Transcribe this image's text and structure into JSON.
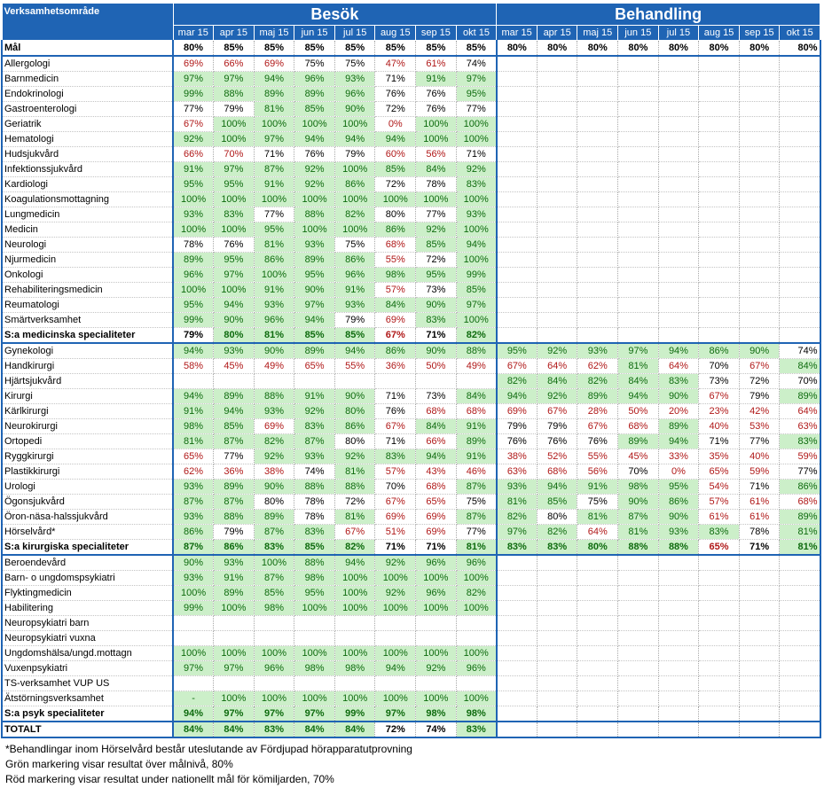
{
  "header": {
    "row_label": "Verksamhetsområde",
    "section_besok": "Besök",
    "section_behandling": "Behandling",
    "months": [
      "mar 15",
      "apr 15",
      "maj 15",
      "jun 15",
      "jul 15",
      "aug 15",
      "sep 15",
      "okt 15"
    ]
  },
  "colors": {
    "header_bg": "#1f64b4",
    "green_fill": "#ccefc9",
    "green_text": "#0e6b0e",
    "red_text": "#b01818"
  },
  "goal_row": {
    "name": "Mål",
    "besok": [
      "80%",
      "85%",
      "85%",
      "85%",
      "85%",
      "85%",
      "85%",
      "85%"
    ],
    "behandling": [
      "80%",
      "80%",
      "80%",
      "80%",
      "80%",
      "80%",
      "80%",
      "80%"
    ]
  },
  "groups": [
    {
      "rows": [
        {
          "name": "Allergologi",
          "besok": [
            "r69%",
            "r66%",
            "r69%",
            "75%",
            "75%",
            "r47%",
            "r61%",
            "74%"
          ],
          "behandling": [
            "",
            "",
            "",
            "",
            "",
            "",
            "",
            ""
          ]
        },
        {
          "name": "Barnmedicin",
          "besok": [
            "g97%",
            "g97%",
            "g94%",
            "g96%",
            "g93%",
            "71%",
            "g91%",
            "g97%"
          ],
          "behandling": [
            "",
            "",
            "",
            "",
            "",
            "",
            "",
            ""
          ]
        },
        {
          "name": "Endokrinologi",
          "besok": [
            "g99%",
            "g88%",
            "g89%",
            "g89%",
            "g96%",
            "76%",
            "76%",
            "g95%"
          ],
          "behandling": [
            "",
            "",
            "",
            "",
            "",
            "",
            "",
            ""
          ]
        },
        {
          "name": "Gastroenterologi",
          "besok": [
            "77%",
            "79%",
            "g81%",
            "g85%",
            "g90%",
            "72%",
            "76%",
            "77%"
          ],
          "behandling": [
            "",
            "",
            "",
            "",
            "",
            "",
            "",
            ""
          ]
        },
        {
          "name": "Geriatrik",
          "besok": [
            "r67%",
            "g100%",
            "g100%",
            "g100%",
            "g100%",
            "r0%",
            "g100%",
            "g100%"
          ],
          "behandling": [
            "",
            "",
            "",
            "",
            "",
            "",
            "",
            ""
          ]
        },
        {
          "name": "Hematologi",
          "besok": [
            "g92%",
            "g100%",
            "g97%",
            "g94%",
            "g94%",
            "g94%",
            "g100%",
            "g100%"
          ],
          "behandling": [
            "",
            "",
            "",
            "",
            "",
            "",
            "",
            ""
          ]
        },
        {
          "name": "Hudsjukvård",
          "besok": [
            "r66%",
            "r70%",
            "71%",
            "76%",
            "79%",
            "r60%",
            "r56%",
            "71%"
          ],
          "behandling": [
            "",
            "",
            "",
            "",
            "",
            "",
            "",
            ""
          ]
        },
        {
          "name": "Infektionssjukvård",
          "besok": [
            "g91%",
            "g97%",
            "g87%",
            "g92%",
            "g100%",
            "g85%",
            "g84%",
            "g92%"
          ],
          "behandling": [
            "",
            "",
            "",
            "",
            "",
            "",
            "",
            ""
          ]
        },
        {
          "name": "Kardiologi",
          "besok": [
            "g95%",
            "g95%",
            "g91%",
            "g92%",
            "g86%",
            "72%",
            "78%",
            "g83%"
          ],
          "behandling": [
            "",
            "",
            "",
            "",
            "",
            "",
            "",
            ""
          ]
        },
        {
          "name": "Koagulationsmottagning",
          "besok": [
            "g100%",
            "g100%",
            "g100%",
            "g100%",
            "g100%",
            "g100%",
            "g100%",
            "g100%"
          ],
          "behandling": [
            "",
            "",
            "",
            "",
            "",
            "",
            "",
            ""
          ]
        },
        {
          "name": "Lungmedicin",
          "besok": [
            "g93%",
            "g83%",
            "77%",
            "g88%",
            "g82%",
            "80%",
            "77%",
            "g93%"
          ],
          "behandling": [
            "",
            "",
            "",
            "",
            "",
            "",
            "",
            ""
          ]
        },
        {
          "name": "Medicin",
          "besok": [
            "g100%",
            "g100%",
            "g95%",
            "g100%",
            "g100%",
            "g86%",
            "g92%",
            "g100%"
          ],
          "behandling": [
            "",
            "",
            "",
            "",
            "",
            "",
            "",
            ""
          ]
        },
        {
          "name": "Neurologi",
          "besok": [
            "78%",
            "76%",
            "g81%",
            "g93%",
            "75%",
            "r68%",
            "g85%",
            "g94%"
          ],
          "behandling": [
            "",
            "",
            "",
            "",
            "",
            "",
            "",
            ""
          ]
        },
        {
          "name": "Njurmedicin",
          "besok": [
            "g89%",
            "g95%",
            "g86%",
            "g89%",
            "g86%",
            "r55%",
            "72%",
            "g100%"
          ],
          "behandling": [
            "",
            "",
            "",
            "",
            "",
            "",
            "",
            ""
          ]
        },
        {
          "name": "Onkologi",
          "besok": [
            "g96%",
            "g97%",
            "g100%",
            "g95%",
            "g96%",
            "g98%",
            "g95%",
            "g99%"
          ],
          "behandling": [
            "",
            "",
            "",
            "",
            "",
            "",
            "",
            ""
          ]
        },
        {
          "name": "Rehabiliteringsmedicin",
          "besok": [
            "g100%",
            "g100%",
            "g91%",
            "g90%",
            "g91%",
            "r57%",
            "73%",
            "g85%"
          ],
          "behandling": [
            "",
            "",
            "",
            "",
            "",
            "",
            "",
            ""
          ]
        },
        {
          "name": "Reumatologi",
          "besok": [
            "g95%",
            "g94%",
            "g93%",
            "g97%",
            "g93%",
            "g84%",
            "g90%",
            "g97%"
          ],
          "behandling": [
            "",
            "",
            "",
            "",
            "",
            "",
            "",
            ""
          ]
        },
        {
          "name": "Smärtverksamhet",
          "besok": [
            "g99%",
            "g90%",
            "g96%",
            "g94%",
            "79%",
            "r69%",
            "g83%",
            "g100%"
          ],
          "behandling": [
            "",
            "",
            "",
            "",
            "",
            "",
            "",
            ""
          ]
        }
      ],
      "summary": {
        "name": "S:a medicinska specialiteter",
        "besok": [
          "79%",
          "g80%",
          "g81%",
          "g85%",
          "g85%",
          "r67%",
          "71%",
          "g82%"
        ],
        "behandling": [
          "",
          "",
          "",
          "",
          "",
          "",
          "",
          ""
        ]
      }
    },
    {
      "rows": [
        {
          "name": "Gynekologi",
          "besok": [
            "g94%",
            "g93%",
            "g90%",
            "g89%",
            "g94%",
            "g86%",
            "g90%",
            "g88%"
          ],
          "behandling": [
            "g95%",
            "g92%",
            "g93%",
            "g97%",
            "g94%",
            "g86%",
            "g90%",
            "74%"
          ]
        },
        {
          "name": "Handkirurgi",
          "besok": [
            "r58%",
            "r45%",
            "r49%",
            "r65%",
            "r55%",
            "r36%",
            "r50%",
            "r49%"
          ],
          "behandling": [
            "r67%",
            "r64%",
            "r62%",
            "g81%",
            "r64%",
            "70%",
            "r67%",
            "g84%"
          ]
        },
        {
          "name": "Hjärtsjukvård",
          "besok": [
            "",
            "",
            "",
            "",
            "",
            "",
            "",
            ""
          ],
          "behandling": [
            "g82%",
            "g84%",
            "g82%",
            "g84%",
            "g83%",
            "73%",
            "72%",
            "70%"
          ]
        },
        {
          "name": "Kirurgi",
          "besok": [
            "g94%",
            "g89%",
            "g88%",
            "g91%",
            "g90%",
            "71%",
            "73%",
            "g84%"
          ],
          "behandling": [
            "g94%",
            "g92%",
            "g89%",
            "g94%",
            "g90%",
            "r67%",
            "79%",
            "g89%"
          ]
        },
        {
          "name": "Kärlkirurgi",
          "besok": [
            "g91%",
            "g94%",
            "g93%",
            "g92%",
            "g80%",
            "76%",
            "r68%",
            "r68%"
          ],
          "behandling": [
            "r69%",
            "r67%",
            "r28%",
            "r50%",
            "r20%",
            "r23%",
            "r42%",
            "r64%"
          ]
        },
        {
          "name": "Neurokirurgi",
          "besok": [
            "g98%",
            "g85%",
            "r69%",
            "g83%",
            "g86%",
            "r67%",
            "g84%",
            "g91%"
          ],
          "behandling": [
            "79%",
            "79%",
            "r67%",
            "r68%",
            "g89%",
            "r40%",
            "r53%",
            "r63%"
          ]
        },
        {
          "name": "Ortopedi",
          "besok": [
            "g81%",
            "g87%",
            "g82%",
            "g87%",
            "80%",
            "71%",
            "r66%",
            "g89%"
          ],
          "behandling": [
            "76%",
            "76%",
            "76%",
            "g89%",
            "g94%",
            "71%",
            "77%",
            "g83%"
          ]
        },
        {
          "name": "Ryggkirurgi",
          "besok": [
            "r65%",
            "77%",
            "g92%",
            "g93%",
            "g92%",
            "g83%",
            "g94%",
            "g91%"
          ],
          "behandling": [
            "r38%",
            "r52%",
            "r55%",
            "r45%",
            "r33%",
            "r35%",
            "r40%",
            "r59%"
          ]
        },
        {
          "name": "Plastikkirurgi",
          "besok": [
            "r62%",
            "r36%",
            "r38%",
            "74%",
            "g81%",
            "r57%",
            "r43%",
            "r46%"
          ],
          "behandling": [
            "r63%",
            "r68%",
            "r56%",
            "70%",
            "r0%",
            "r65%",
            "r59%",
            "77%"
          ]
        },
        {
          "name": "Urologi",
          "besok": [
            "g93%",
            "g89%",
            "g90%",
            "g88%",
            "g88%",
            "70%",
            "r68%",
            "g87%"
          ],
          "behandling": [
            "g93%",
            "g94%",
            "g91%",
            "g98%",
            "g95%",
            "r54%",
            "71%",
            "g86%"
          ]
        },
        {
          "name": "Ögonsjukvård",
          "besok": [
            "g87%",
            "g87%",
            "80%",
            "78%",
            "72%",
            "r67%",
            "r65%",
            "75%"
          ],
          "behandling": [
            "g81%",
            "g85%",
            "75%",
            "g90%",
            "g86%",
            "r57%",
            "r61%",
            "r68%"
          ]
        },
        {
          "name": "Öron-näsa-halssjukvård",
          "besok": [
            "g93%",
            "g88%",
            "g89%",
            "78%",
            "g81%",
            "r69%",
            "r69%",
            "g87%"
          ],
          "behandling": [
            "g82%",
            "80%",
            "g81%",
            "g87%",
            "g90%",
            "r61%",
            "r61%",
            "g89%"
          ]
        },
        {
          "name": "Hörselvård*",
          "besok": [
            "g86%",
            "79%",
            "g87%",
            "g83%",
            "r67%",
            "r51%",
            "r69%",
            "77%"
          ],
          "behandling": [
            "g97%",
            "g82%",
            "r64%",
            "g81%",
            "g93%",
            "g83%",
            "78%",
            "g81%"
          ]
        }
      ],
      "summary": {
        "name": "S:a kirurgiska specialiteter",
        "besok": [
          "g87%",
          "g86%",
          "g83%",
          "g85%",
          "g82%",
          "71%",
          "71%",
          "g81%"
        ],
        "behandling": [
          "g83%",
          "g83%",
          "g80%",
          "g88%",
          "g88%",
          "r65%",
          "71%",
          "g81%"
        ]
      }
    },
    {
      "rows": [
        {
          "name": "Beroendevård",
          "besok": [
            "g90%",
            "g93%",
            "g100%",
            "g88%",
            "g94%",
            "g92%",
            "g96%",
            "g96%"
          ],
          "behandling": [
            "",
            "",
            "",
            "",
            "",
            "",
            "",
            ""
          ]
        },
        {
          "name": "Barn- o ungdomspsykiatri",
          "besok": [
            "g93%",
            "g91%",
            "g87%",
            "g98%",
            "g100%",
            "g100%",
            "g100%",
            "g100%"
          ],
          "behandling": [
            "",
            "",
            "",
            "",
            "",
            "",
            "",
            ""
          ]
        },
        {
          "name": "Flyktingmedicin",
          "besok": [
            "g100%",
            "g89%",
            "g85%",
            "g95%",
            "g100%",
            "g92%",
            "g96%",
            "g82%"
          ],
          "behandling": [
            "",
            "",
            "",
            "",
            "",
            "",
            "",
            ""
          ]
        },
        {
          "name": "Habilitering",
          "besok": [
            "g99%",
            "g100%",
            "g98%",
            "g100%",
            "g100%",
            "g100%",
            "g100%",
            "g100%"
          ],
          "behandling": [
            "",
            "",
            "",
            "",
            "",
            "",
            "",
            ""
          ]
        },
        {
          "name": "Neuropsykiatri barn",
          "besok": [
            "",
            "",
            "",
            "",
            "",
            "",
            "",
            ""
          ],
          "behandling": [
            "",
            "",
            "",
            "",
            "",
            "",
            "",
            ""
          ]
        },
        {
          "name": "Neuropsykiatri vuxna",
          "besok": [
            "",
            "",
            "",
            "",
            "",
            "",
            "",
            ""
          ],
          "behandling": [
            "",
            "",
            "",
            "",
            "",
            "",
            "",
            ""
          ]
        },
        {
          "name": "Ungdomshälsa/ungd.mottagn",
          "besok": [
            "g100%",
            "g100%",
            "g100%",
            "g100%",
            "g100%",
            "g100%",
            "g100%",
            "g100%"
          ],
          "behandling": [
            "",
            "",
            "",
            "",
            "",
            "",
            "",
            ""
          ]
        },
        {
          "name": "Vuxenpsykiatri",
          "besok": [
            "g97%",
            "g97%",
            "g96%",
            "g98%",
            "g98%",
            "g94%",
            "g92%",
            "g96%"
          ],
          "behandling": [
            "",
            "",
            "",
            "",
            "",
            "",
            "",
            ""
          ]
        },
        {
          "name": "TS-verksamhet VUP US",
          "besok": [
            "",
            "",
            "",
            "",
            "",
            "",
            "",
            ""
          ],
          "behandling": [
            "",
            "",
            "",
            "",
            "",
            "",
            "",
            ""
          ]
        },
        {
          "name": "Ätstörningsverksamhet",
          "besok": [
            "g-",
            "g100%",
            "g100%",
            "g100%",
            "g100%",
            "g100%",
            "g100%",
            "g100%"
          ],
          "behandling": [
            "",
            "",
            "",
            "",
            "",
            "",
            "",
            ""
          ]
        }
      ],
      "summary": {
        "name": "S:a psyk specialiteter",
        "besok": [
          "g94%",
          "g97%",
          "g97%",
          "g97%",
          "g99%",
          "g97%",
          "g98%",
          "g98%"
        ],
        "behandling": [
          "",
          "",
          "",
          "",
          "",
          "",
          "",
          ""
        ]
      }
    }
  ],
  "total_row": {
    "name": "TOTALT",
    "besok": [
      "g84%",
      "g84%",
      "g83%",
      "g84%",
      "g84%",
      "72%",
      "74%",
      "g83%"
    ],
    "behandling": [
      "",
      "",
      "",
      "",
      "",
      "",
      "",
      ""
    ]
  },
  "notes": [
    "*Behandlingar inom Hörselvård består uteslutande av Fördjupad hörapparatutprovning",
    "Grön markering visar resultat över målnivå, 80%",
    "Röd markering visar resultat under nationellt mål för kömiljarden, 70%"
  ]
}
